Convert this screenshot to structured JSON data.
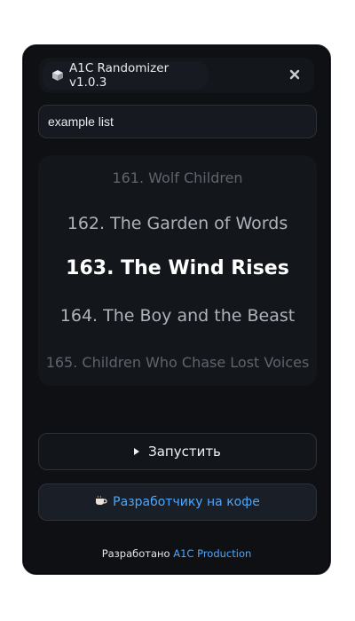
{
  "window": {
    "title": "A1C Randomizer v1.0.3",
    "title_icon": "cube-icon",
    "close_icon": "close-icon"
  },
  "list_input": {
    "value": "example list"
  },
  "wheel": {
    "items": [
      "161. Wolf Children",
      "162. The Garden of Words",
      "163. The Wind Rises",
      "164. The Boy and the Beast",
      "165. Children Who Chase Lost Voices"
    ],
    "selected_index": 2
  },
  "buttons": {
    "run_label": "Запустить",
    "run_icon": "play-icon",
    "coffee_label": "Разработчику на кофе",
    "coffee_icon": "coffee-icon"
  },
  "footer": {
    "prefix": "Разработано",
    "link": "A1C Production"
  },
  "colors": {
    "panel_bg": "#0e1014",
    "accent_link": "#4aa8ff",
    "text_primary": "#ffffff"
  }
}
